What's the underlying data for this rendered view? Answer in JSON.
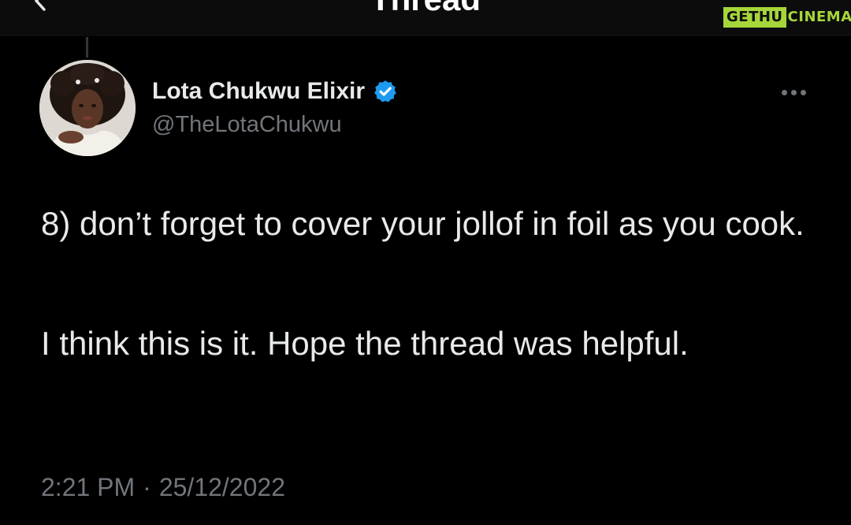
{
  "header": {
    "title": "Thread",
    "back_icon": "arrow-left-icon"
  },
  "watermark": {
    "part1": "GETHU",
    "part2": "CINEMA",
    "color": "#a6d63a"
  },
  "tweet": {
    "display_name": "Lota Chukwu Elixir",
    "verified": true,
    "verified_color": "#1d9bf0",
    "handle": "@TheLotaChukwu",
    "more_icon": "ellipsis-icon",
    "paragraphs": [
      "8) don’t forget to cover your jollof in foil as you cook.",
      "I think this is it. Hope the thread was helpful."
    ],
    "time": "2:21 PM",
    "separator": "·",
    "date": "25/12/2022"
  },
  "colors": {
    "background": "#000000",
    "text_primary": "#e7e9ea",
    "text_secondary": "#71767b"
  }
}
